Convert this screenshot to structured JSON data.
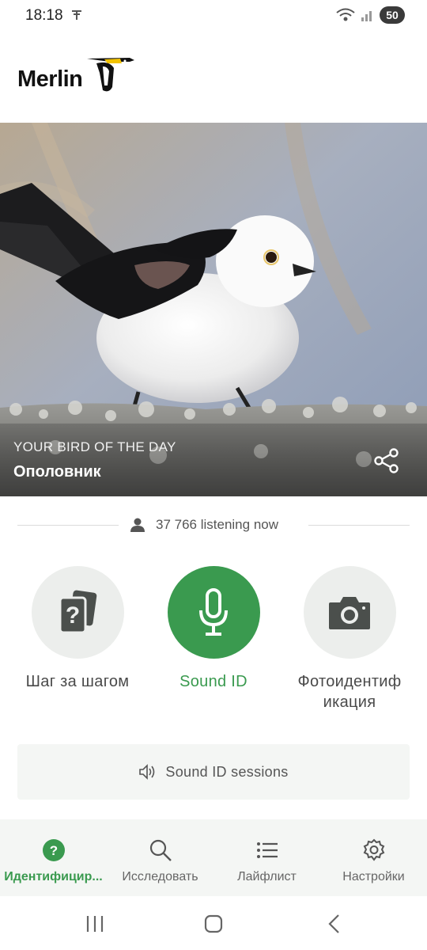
{
  "status_bar": {
    "time": "18:18",
    "battery": "50"
  },
  "header": {
    "logo_text": "Merlin"
  },
  "hero": {
    "kicker": "YOUR BIRD OF THE DAY",
    "bird_name": "Ополовник"
  },
  "listening": {
    "text": "37 766 listening now"
  },
  "actions": {
    "step_by_step": "Шаг за шагом",
    "sound_id": "Sound ID",
    "photo_id_line1": "Фотоидентиф",
    "photo_id_line2": "икация"
  },
  "sessions": {
    "label": "Sound ID sessions"
  },
  "bottom_nav": {
    "identify": "Идентифицир...",
    "explore": "Исследовать",
    "lifelist": "Лайфлист",
    "settings": "Настройки"
  },
  "colors": {
    "accent": "#3a9a4f",
    "action_bg": "#eceeec",
    "nav_bg": "#f4f6f4"
  }
}
